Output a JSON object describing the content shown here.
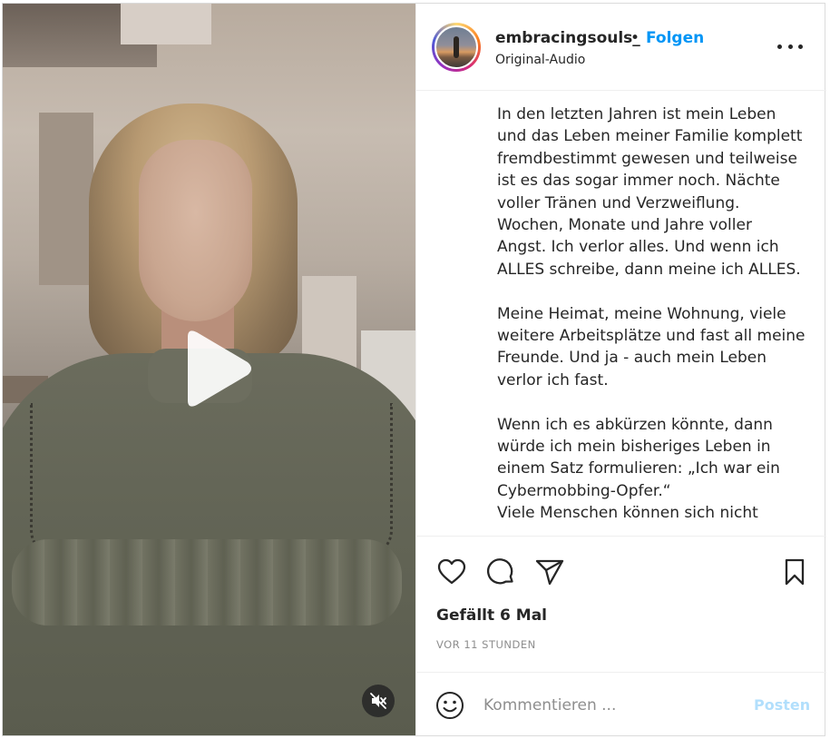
{
  "header": {
    "username": "embracingsouls_",
    "separator": "•",
    "follow_label": "Folgen",
    "audio_label": "Original-Audio"
  },
  "caption": {
    "paragraphs": [
      "In den letzten Jahren ist mein Leben und das Leben meiner Familie komplett fremdbestimmt gewesen und teilweise ist es das sogar immer noch. Nächte voller Tränen und Verzweiflung. Wochen, Monate und Jahre voller Angst. Ich verlor alles. Und wenn ich ALLES schreibe, dann meine ich ALLES.",
      "Meine Heimat, meine Wohnung, viele weitere Arbeitsplätze und fast all meine Freunde. Und ja - auch mein Leben verlor ich fast.",
      "Wenn ich es abkürzen könnte, dann würde ich mein bisheriges Leben in einem Satz formulieren: „Ich war ein Cybermobbing-Opfer.“\nViele Menschen können sich nicht"
    ]
  },
  "actions": {
    "like_icon": "heart-icon",
    "comment_icon": "speech-bubble-icon",
    "share_icon": "paper-plane-icon",
    "save_icon": "bookmark-icon",
    "likes_text": "Gefällt 6 Mal",
    "time_text": "VOR 11 STUNDEN"
  },
  "comment": {
    "placeholder": "Kommentieren ...",
    "post_label": "Posten",
    "emoji_icon": "smiley-icon"
  },
  "video": {
    "play_icon": "play-icon",
    "mute_icon": "muted-speaker-icon"
  },
  "colors": {
    "accent": "#0095f6",
    "post_disabled": "#b2dffc",
    "muted_text": "#8e8e8e",
    "text": "#262626"
  }
}
